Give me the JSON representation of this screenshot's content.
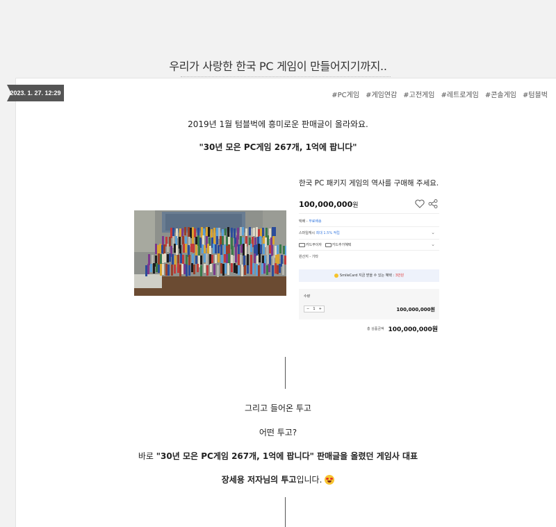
{
  "post": {
    "title": "우리가 사랑한 한국 PC 게임이 만들어지기까지..",
    "date": "2023. 1. 27. 12:29",
    "tags": [
      "#PC게임",
      "#게임연감",
      "#고전게임",
      "#레트로게임",
      "#콘솔게임",
      "#텀블벅"
    ]
  },
  "body": {
    "intro": "2019년 1월 텀블벅에 흥미로운 판매글이 올라와요.",
    "quote": "\"30년 모은 PC게임 267개, 1억에 팝니다\"",
    "line_1": "그리고 들어온 투고",
    "line_2": "어떤 투고?",
    "line_3_prefix": "바로 ",
    "line_3_bold": "\"30년 모은 PC게임 267개, 1억에 팝니다\"  판매글을 올렸던 게임사 대표",
    "line_4_bold": "장세용 저자님의 투고",
    "line_4_suffix": "입니다.",
    "emoji_icon": "heart-eyes-emoji-icon"
  },
  "listing": {
    "title": "한국 PC 패키지 게임의 역사를 구매해 주세요.",
    "price": "100,000,000",
    "price_unit": "원",
    "delivery_label": "택배 - ",
    "delivery_value": "무료배송",
    "smile_prefix": "스마일캐시 ",
    "smile_highlight": "최대 1.5% 적립",
    "card_1": "카드무이자",
    "card_2": "카드추가혜택",
    "origin": "원산지 - 기타",
    "smilecard_prefix": "SmileCard  지금 받을 수 있는 혜택 : ",
    "smilecard_highlight": "3만원",
    "qty_label": "수량",
    "qty_minus": "−",
    "qty_value": "1",
    "qty_plus": "+",
    "qty_price": "100,000,000원",
    "total_label": "총 상품금액",
    "total_price": "100,000,000원"
  },
  "colors": {
    "date_badge": "#555555",
    "accent_blue": "#3a7be0",
    "accent_red": "#e03a3a"
  }
}
